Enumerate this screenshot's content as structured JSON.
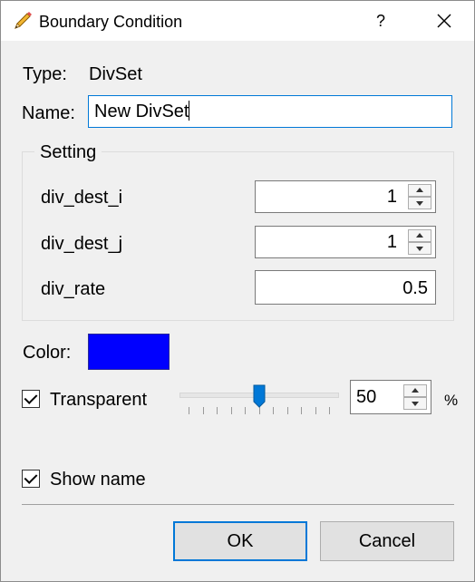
{
  "dialog": {
    "title": "Boundary Condition",
    "help_label": "?"
  },
  "fields": {
    "type_label": "Type:",
    "type_value": "DivSet",
    "name_label": "Name:",
    "name_value": "New DivSet"
  },
  "setting": {
    "group_title": "Setting",
    "rows": [
      {
        "label": "div_dest_i",
        "value": "1"
      },
      {
        "label": "div_dest_j",
        "value": "1"
      },
      {
        "label": "div_rate",
        "value": "0.5"
      }
    ]
  },
  "color": {
    "label": "Color:",
    "value": "#0000ff"
  },
  "transparent": {
    "label": "Transparent",
    "checked": true,
    "slider_value": 50,
    "spin_value": "50",
    "unit": "%"
  },
  "show_name": {
    "label": "Show name",
    "checked": true
  },
  "buttons": {
    "ok": "OK",
    "cancel": "Cancel"
  },
  "icons": {
    "title": "pencil-icon",
    "close": "close-icon"
  }
}
